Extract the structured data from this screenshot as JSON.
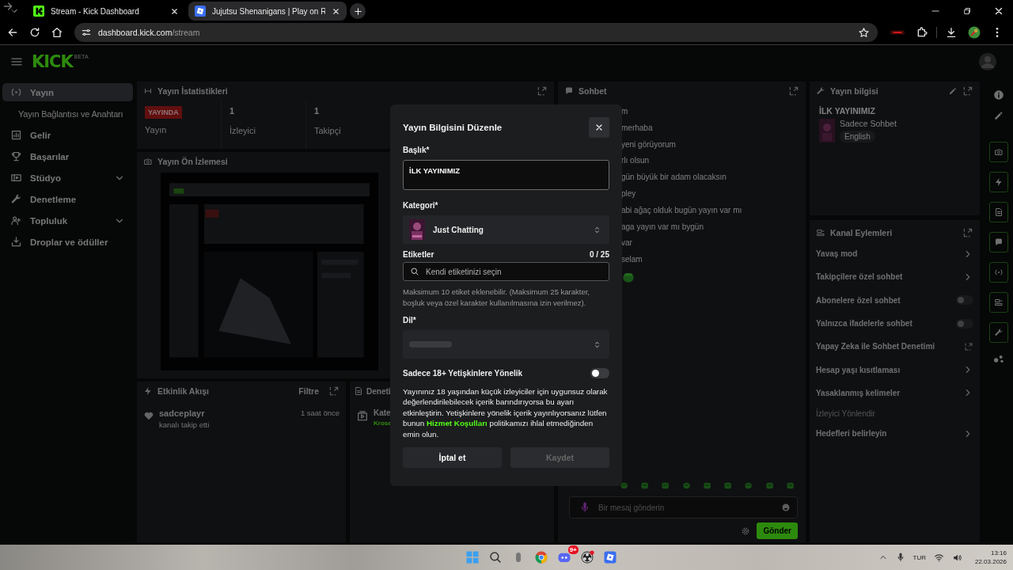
{
  "browser": {
    "tabs": [
      {
        "title": "Stream - Kick Dashboard",
        "selected": true
      },
      {
        "title": "Jujutsu Shenanigans | Play on R",
        "selected": false
      }
    ],
    "address": {
      "host": "dashboard.kick.com",
      "path": "/stream"
    }
  },
  "header": {
    "logo": "KICK",
    "logo_badge": "BETA"
  },
  "sidebar": {
    "items": [
      {
        "label": "Yayın",
        "kind": "link",
        "selected": true
      },
      {
        "label": "Yayın Bağlantısı ve Anahtarı",
        "kind": "sub",
        "selected": false
      },
      {
        "label": "Gelir",
        "kind": "link",
        "selected": false
      },
      {
        "label": "Başarılar",
        "kind": "link",
        "selected": false
      },
      {
        "label": "Stüdyo",
        "kind": "group",
        "selected": false,
        "expanded": false
      },
      {
        "label": "Denetleme",
        "kind": "link",
        "selected": false
      },
      {
        "label": "Topluluk",
        "kind": "group",
        "selected": false,
        "expanded": false
      },
      {
        "label": "Droplar ve ödüller",
        "kind": "link",
        "selected": false
      }
    ]
  },
  "stats": {
    "title": "Yayın İstatistikleri",
    "cards": [
      {
        "kind": "badge",
        "value": "YAYINDA",
        "label": "Yayın"
      },
      {
        "kind": "number",
        "value": "1",
        "label": "İzleyici"
      },
      {
        "kind": "number",
        "value": "1",
        "label": "Takipçi"
      }
    ]
  },
  "preview": {
    "title": "Yayın Ön İzlemesi"
  },
  "activity": {
    "title": "Etkinlik Akışı",
    "filter": "Filtre",
    "events": [
      {
        "user": "sadceplayr",
        "action": "kanalı takip etti",
        "time": "1 saat önce"
      }
    ]
  },
  "moderation": {
    "title": "Deneti",
    "items": [
      {
        "title": "Kate",
        "subtitle": "Krose"
      }
    ]
  },
  "chat": {
    "title": "Sohbet",
    "messages": [
      {
        "kind": "text",
        "text": "m"
      },
      {
        "kind": "text",
        "text": "merhaba"
      },
      {
        "kind": "text",
        "text": "yeni görüyorum"
      },
      {
        "kind": "text",
        "text": "rlı olsun"
      },
      {
        "kind": "text",
        "text": "gün büyük bir adam olacaksın"
      },
      {
        "kind": "text",
        "text": "pley"
      },
      {
        "kind": "text",
        "text": "abi ağaç olduk bugün yayın var mı"
      },
      {
        "kind": "text",
        "text": "aga yayın var mı bygün"
      },
      {
        "kind": "text",
        "text": "var"
      },
      {
        "kind": "text",
        "text": "selam"
      },
      {
        "kind": "emote"
      }
    ],
    "input_placeholder": "Bir mesaj gönderin",
    "send": "Gönder"
  },
  "stream_info": {
    "title": "Yayın bilgisi",
    "stream_title": "İLK YAYINIMIZ",
    "category": "Sadece Sohbet",
    "language": "English"
  },
  "channel_actions": {
    "title": "Kanal Eylemleri",
    "items": [
      {
        "label": "Yavaş mod",
        "kind": "chevron"
      },
      {
        "label": "Takipçilere özel sohbet",
        "kind": "chevron"
      },
      {
        "label": "Abonelere özel sohbet",
        "kind": "toggle",
        "on": false
      },
      {
        "label": "Yalnızca ifadelerle sohbet",
        "kind": "toggle",
        "on": false
      },
      {
        "label": "Yapay Zeka ile Sohbet Denetimi",
        "kind": "external"
      },
      {
        "label": "Hesap yaşı kısıtlaması",
        "kind": "chevron"
      },
      {
        "label": "Yasaklanmış kelimeler",
        "kind": "chevron"
      },
      {
        "label": "İzleyici Yönlendir",
        "kind": "muted"
      },
      {
        "label": "Hedefleri belirleyin",
        "kind": "chevron"
      }
    ]
  },
  "modal": {
    "title": "Yayın Bilgisini Düzenle",
    "title_field": {
      "label": "Başlık*",
      "value": "İLK YAYINIMIZ"
    },
    "category": {
      "label": "Kategori*",
      "value": "Just Chatting"
    },
    "tags": {
      "label": "Etiketler",
      "count": "0 / 25",
      "placeholder": "Kendi etiketinizi seçin",
      "hint": "Maksimum 10 etiket eklenebilir. (Maksimum 25 karakter, boşluk veya özel karakter kullanılmasına izin verilmez)."
    },
    "language": {
      "label": "Dil*",
      "loading": true
    },
    "adult": {
      "label": "Sadece 18+ Yetişkinlere Yönelik",
      "on": false,
      "description": "Yayınınız 18 yaşından küçük izleyiciler için uygunsuz olarak değerlendirilebilecek içerik barındırıyorsa bu ayarı etkinleştirin. Yetişkinlere yönelik içerik yayınlıyorsanız lütfen bunun ",
      "link": "Hizmet Koşulları",
      "description_end": " politikamızı ihlal etmediğinden emin olun."
    },
    "buttons": [
      {
        "label": "İptal et",
        "kind": "secondary",
        "disabled": false
      },
      {
        "label": "Kaydet",
        "kind": "primary",
        "disabled": true
      }
    ]
  },
  "taskbar": {
    "notification_badge": "9+",
    "tray": {
      "language": "TUR",
      "time": "13:16",
      "date": "22.03.2026"
    }
  }
}
